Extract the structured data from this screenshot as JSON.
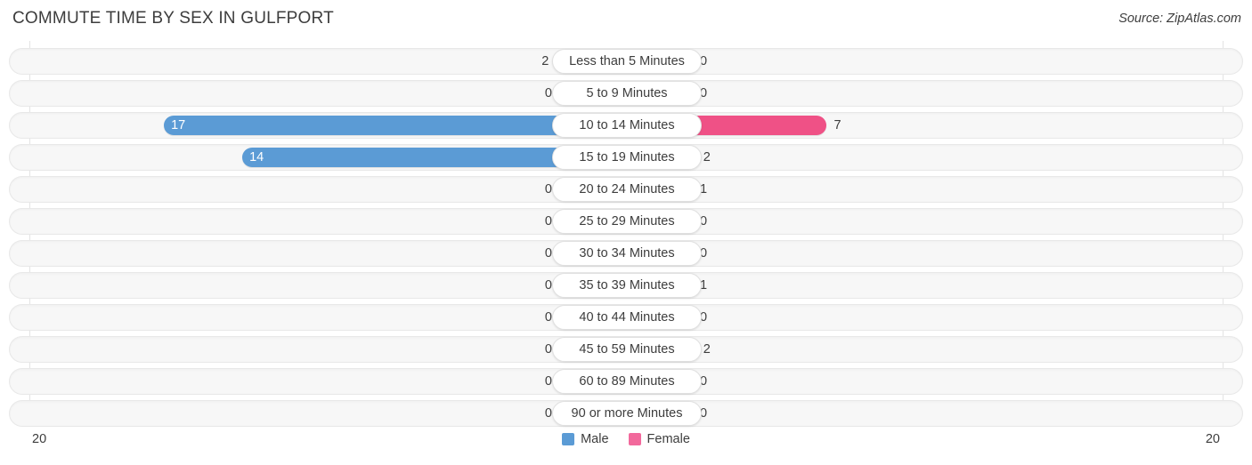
{
  "header": {
    "title": "COMMUTE TIME BY SEX IN GULFPORT",
    "source": "Source: ZipAtlas.com"
  },
  "axis": {
    "left_tick": "20",
    "right_tick": "20",
    "max": 20
  },
  "legend": {
    "items": [
      {
        "label": "Male",
        "color": "#5b9bd5"
      },
      {
        "label": "Female",
        "color": "#f2699c"
      }
    ]
  },
  "colors": {
    "male_strong": "#5b9bd5",
    "male_light": "#aecbeb",
    "female_strong": "#f2699c",
    "female_strongest": "#ef5186",
    "female_light": "#f9a7c3",
    "track": "#f7f7f7",
    "track_border": "#e8e8e8"
  },
  "chart_data": {
    "type": "bar",
    "title": "COMMUTE TIME BY SEX IN GULFPORT",
    "subtitle": "Source: ZipAtlas.com",
    "orientation": "horizontal-diverging",
    "xlabel": "",
    "ylabel": "",
    "xlim": [
      -20,
      20
    ],
    "axis_ticks": [
      "20",
      "20"
    ],
    "grid": false,
    "legend_position": "bottom-center",
    "categories": [
      "Less than 5 Minutes",
      "5 to 9 Minutes",
      "10 to 14 Minutes",
      "15 to 19 Minutes",
      "20 to 24 Minutes",
      "25 to 29 Minutes",
      "30 to 34 Minutes",
      "35 to 39 Minutes",
      "40 to 44 Minutes",
      "45 to 59 Minutes",
      "60 to 89 Minutes",
      "90 or more Minutes"
    ],
    "series": [
      {
        "name": "Male",
        "values": [
          2,
          0,
          17,
          14,
          0,
          0,
          0,
          0,
          0,
          0,
          0,
          0
        ]
      },
      {
        "name": "Female",
        "values": [
          0,
          0,
          7,
          2,
          1,
          0,
          0,
          1,
          0,
          2,
          0,
          0
        ]
      }
    ]
  },
  "rows": [
    {
      "label": "Less than 5 Minutes",
      "male": "2",
      "female": "0"
    },
    {
      "label": "5 to 9 Minutes",
      "male": "0",
      "female": "0"
    },
    {
      "label": "10 to 14 Minutes",
      "male": "17",
      "female": "7"
    },
    {
      "label": "15 to 19 Minutes",
      "male": "14",
      "female": "2"
    },
    {
      "label": "20 to 24 Minutes",
      "male": "0",
      "female": "1"
    },
    {
      "label": "25 to 29 Minutes",
      "male": "0",
      "female": "0"
    },
    {
      "label": "30 to 34 Minutes",
      "male": "0",
      "female": "0"
    },
    {
      "label": "35 to 39 Minutes",
      "male": "0",
      "female": "1"
    },
    {
      "label": "40 to 44 Minutes",
      "male": "0",
      "female": "0"
    },
    {
      "label": "45 to 59 Minutes",
      "male": "0",
      "female": "2"
    },
    {
      "label": "60 to 89 Minutes",
      "male": "0",
      "female": "0"
    },
    {
      "label": "90 or more Minutes",
      "male": "0",
      "female": "0"
    }
  ]
}
